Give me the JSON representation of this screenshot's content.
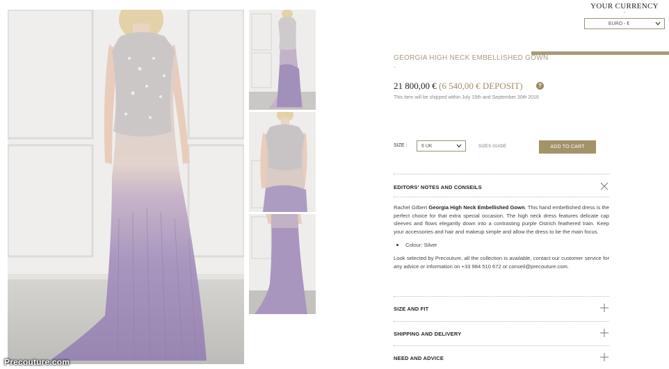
{
  "watermark": "Precouture.com",
  "currency": {
    "title": "YOUR CURRENCY",
    "dash": "-",
    "selected": "EURO - €"
  },
  "product": {
    "title": "GEORGIA HIGH NECK EMBELLISHED GOWN",
    "title_dash": "-",
    "price": "21 800,00 €",
    "deposit": "(6 540,00 € DEPOSIT)",
    "help_icon": "?",
    "shipping_note": "This item will be shipped within July 15th and September 30th 2016"
  },
  "size": {
    "label": "SIZE :",
    "selected": "6 UK",
    "guide": "SIZES GUIDE"
  },
  "add_to_cart": "ADD TO CART",
  "editors": {
    "heading": "EDITORS' NOTES AND CONSEILS",
    "desc_prefix": "Rachel Gilbert ",
    "desc_bold": "Georgia High Neck Embellished Gown",
    "desc_rest": ". This hand embellished dress is the perfect choice for that extra special occasion. The high neck dress features delicate cap sleeves and flows elegantly down into a contrasting purple Ostrich feathered train. Keep your accessories and hair and makeup simple and allow the dress to be the main focus.",
    "colour": "Colour: Silver",
    "contact": "Look selected by Precouture, all the collection is available, contact our customer service for any advice or information on +33 984 510 672 or conseil@precouture.com."
  },
  "accordion": {
    "size_fit": "SIZE AND FIT",
    "shipping": "SHIPPING AND DELIVERY",
    "advice": "NEED AND ADVICE"
  },
  "colors": {
    "gold": "#a3926a",
    "gold_text": "#a79a7d",
    "lavender": "#a593bd"
  },
  "icons": [
    "chevron-down-icon",
    "question-icon",
    "close-icon",
    "plus-icon"
  ]
}
